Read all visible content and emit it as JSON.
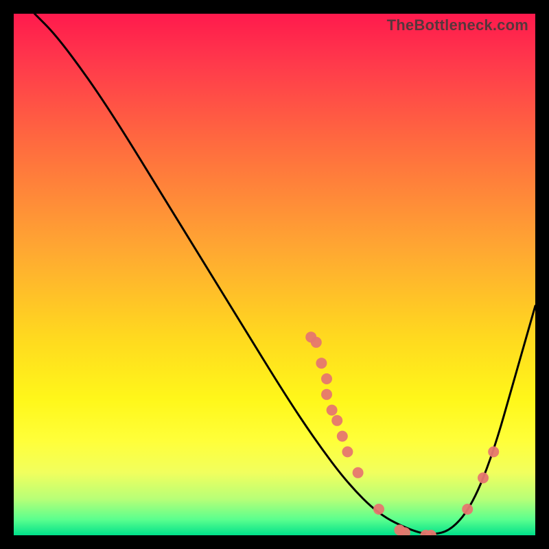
{
  "watermark": "TheBottleneck.com",
  "chart_data": {
    "type": "line",
    "title": "",
    "xlabel": "",
    "ylabel": "",
    "xlim": [
      0,
      100
    ],
    "ylim": [
      0,
      100
    ],
    "series": [
      {
        "name": "curve",
        "x": [
          4,
          8,
          14,
          20,
          28,
          36,
          44,
          52,
          58,
          64,
          70,
          76,
          80,
          84,
          88,
          92,
          96,
          100
        ],
        "y": [
          100,
          96,
          88,
          79,
          66,
          53,
          40,
          27,
          18,
          10,
          4,
          1,
          0,
          1,
          6,
          16,
          30,
          44
        ]
      }
    ],
    "points": [
      {
        "x": 57,
        "y": 38
      },
      {
        "x": 58,
        "y": 37
      },
      {
        "x": 59,
        "y": 33
      },
      {
        "x": 60,
        "y": 30
      },
      {
        "x": 60,
        "y": 27
      },
      {
        "x": 61,
        "y": 24
      },
      {
        "x": 62,
        "y": 22
      },
      {
        "x": 63,
        "y": 19
      },
      {
        "x": 64,
        "y": 16
      },
      {
        "x": 66,
        "y": 12
      },
      {
        "x": 70,
        "y": 5
      },
      {
        "x": 74,
        "y": 1
      },
      {
        "x": 75,
        "y": 0.5
      },
      {
        "x": 79,
        "y": 0
      },
      {
        "x": 80,
        "y": 0
      },
      {
        "x": 87,
        "y": 5
      },
      {
        "x": 90,
        "y": 11
      },
      {
        "x": 92,
        "y": 16
      }
    ],
    "dot_color": "#e6776f",
    "curve_color": "#000000",
    "background_gradient": [
      "#ff1a4d",
      "#ffd91f",
      "#00e08a"
    ]
  }
}
